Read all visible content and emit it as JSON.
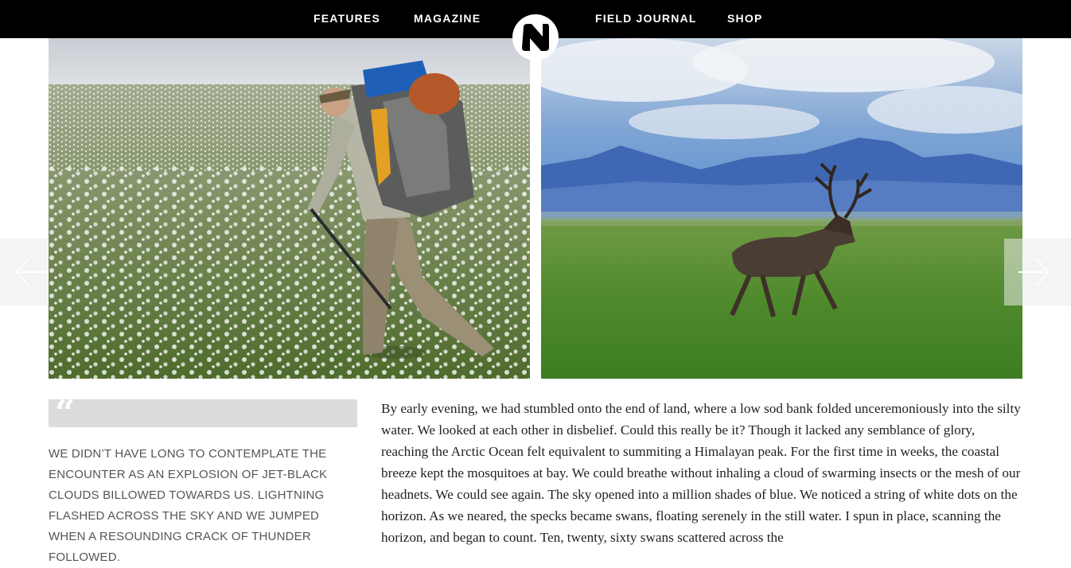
{
  "nav": {
    "links": [
      "FEATURES",
      "MAGAZINE",
      "FIELD JOURNAL",
      "SHOP"
    ]
  },
  "gallery": {
    "prev_icon": "arrow-left-icon",
    "next_icon": "arrow-right-icon"
  },
  "pull_quote": {
    "icon": "quote-icon",
    "text": "WE DIDN’T HAVE LONG TO CONTEMPLATE THE ENCOUNTER AS AN EXPLOSION OF JET-BLACK CLOUDS BILLOWED TOWARDS US. LIGHTNING FLASHED ACROSS THE SKY AND WE JUMPED WHEN A RESOUNDING CRACK OF THUNDER FOLLOWED."
  },
  "article": {
    "paragraph": "By early evening, we had stumbled onto the end of land, where a low sod bank folded unceremoniously into the silty water. We looked at each other in disbelief. Could this really be it? Though it lacked any semblance of glory, reaching the Arctic Ocean felt equivalent to summiting a Himalayan peak. For the first time in weeks, the coastal breeze kept the mosquitoes at bay. We could breathe without inhaling a cloud of swarming insects or the mesh of our headnets. We could see again. The sky opened into a million shades of blue. We noticed a string of white dots on the horizon. As we neared, the specks became swans, floating serenely in the still water. I spun in place, scanning the horizon, and began to count. Ten, twenty, sixty swans scattered across the"
  },
  "colors": {
    "nav_bg": "#000000",
    "quote_box": "#dcdcdc",
    "quote_text": "#555555"
  }
}
